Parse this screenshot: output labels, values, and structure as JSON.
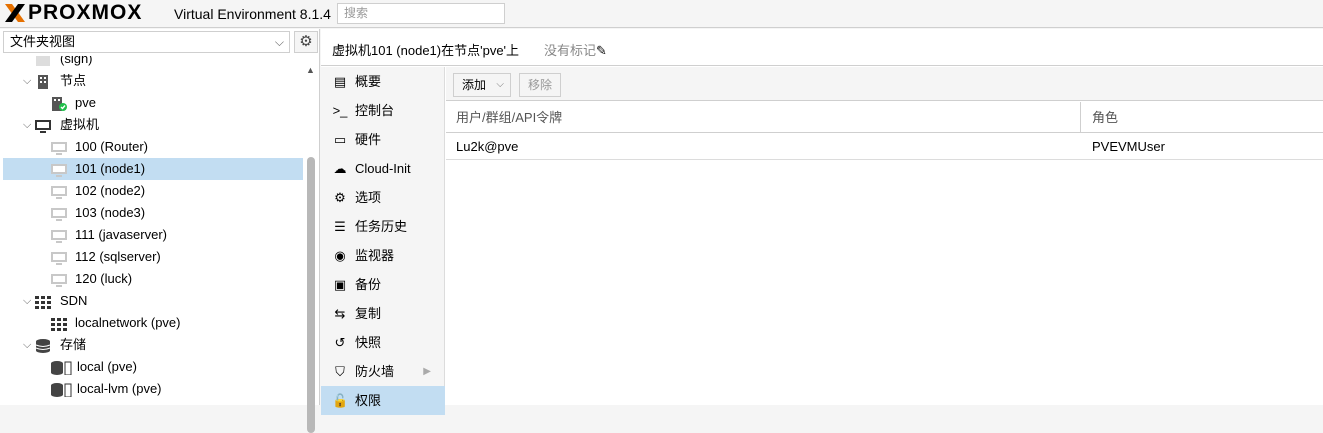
{
  "header": {
    "brand": "PROXMOX",
    "product": "Virtual Environment 8.1.4",
    "search_placeholder": "搜索",
    "brand_color": "#e57000"
  },
  "sidebar": {
    "view_select": "文件夹视图",
    "tree": [
      {
        "label": "(sign)",
        "icon": "partial-icon",
        "indent": 1,
        "arrow": "",
        "selected": false
      },
      {
        "label": "节点",
        "icon": "server-icon",
        "indent": 1,
        "arrow": "v",
        "selected": false
      },
      {
        "label": "pve",
        "icon": "node-online-icon",
        "indent": 2,
        "arrow": "",
        "selected": false
      },
      {
        "label": "虚拟机",
        "icon": "monitor-icon",
        "indent": 1,
        "arrow": "v",
        "selected": false
      },
      {
        "label": "100 (Router)",
        "icon": "vm-stopped-icon",
        "indent": 2,
        "arrow": "",
        "selected": false
      },
      {
        "label": "101 (node1)",
        "icon": "vm-stopped-icon",
        "indent": 2,
        "arrow": "",
        "selected": true
      },
      {
        "label": "102 (node2)",
        "icon": "vm-stopped-icon",
        "indent": 2,
        "arrow": "",
        "selected": false
      },
      {
        "label": "103 (node3)",
        "icon": "vm-stopped-icon",
        "indent": 2,
        "arrow": "",
        "selected": false
      },
      {
        "label": "111 (javaserver)",
        "icon": "vm-stopped-icon",
        "indent": 2,
        "arrow": "",
        "selected": false
      },
      {
        "label": "112 (sqlserver)",
        "icon": "vm-stopped-icon",
        "indent": 2,
        "arrow": "",
        "selected": false
      },
      {
        "label": "120 (luck)",
        "icon": "vm-stopped-icon",
        "indent": 2,
        "arrow": "",
        "selected": false
      },
      {
        "label": "SDN",
        "icon": "sdn-grid-icon",
        "indent": 1,
        "arrow": "v",
        "selected": false
      },
      {
        "label": "localnetwork (pve)",
        "icon": "sdn-grid-icon",
        "indent": 2,
        "arrow": "",
        "selected": false
      },
      {
        "label": "存储",
        "icon": "database-icon",
        "indent": 1,
        "arrow": "v",
        "selected": false
      },
      {
        "label": "local (pve)",
        "icon": "storage-icon",
        "indent": 2,
        "arrow": "",
        "selected": false
      },
      {
        "label": "local-lvm (pve)",
        "icon": "storage-icon",
        "indent": 2,
        "arrow": "",
        "selected": false
      },
      {
        "label": "",
        "icon": "storage-icon",
        "indent": 2,
        "arrow": "",
        "selected": false
      }
    ]
  },
  "breadcrumb": {
    "title": "虚拟机101 (node1)在节点'pve'上",
    "tags": "没有标记"
  },
  "menu": [
    {
      "label": "概要",
      "icon": "summary-icon",
      "glyph": "▤",
      "selected": false
    },
    {
      "label": "控制台",
      "icon": "terminal-icon",
      "glyph": ">_",
      "selected": false
    },
    {
      "label": "硬件",
      "icon": "desktop-icon",
      "glyph": "▭",
      "selected": false
    },
    {
      "label": "Cloud-Init",
      "icon": "cloud-icon",
      "glyph": "☁",
      "selected": false
    },
    {
      "label": "选项",
      "icon": "gear-icon",
      "glyph": "⚙",
      "selected": false
    },
    {
      "label": "任务历史",
      "icon": "list-icon",
      "glyph": "☰",
      "selected": false
    },
    {
      "label": "监视器",
      "icon": "eye-icon",
      "glyph": "◉",
      "selected": false
    },
    {
      "label": "备份",
      "icon": "floppy-icon",
      "glyph": "▣",
      "selected": false
    },
    {
      "label": "复制",
      "icon": "retweet-icon",
      "glyph": "⇆",
      "selected": false
    },
    {
      "label": "快照",
      "icon": "history-icon",
      "glyph": "↺",
      "selected": false
    },
    {
      "label": "防火墙",
      "icon": "shield-icon",
      "glyph": "⛉",
      "selected": false,
      "has_submenu": true
    },
    {
      "label": "权限",
      "icon": "unlock-icon",
      "glyph": "🔓",
      "selected": true
    }
  ],
  "toolbar": {
    "add_label": "添加",
    "remove_label": "移除"
  },
  "grid": {
    "columns": [
      "用户/群组/API令牌",
      "角色"
    ],
    "rows": [
      [
        "Lu2k@pve",
        "PVEVMUser"
      ]
    ]
  }
}
